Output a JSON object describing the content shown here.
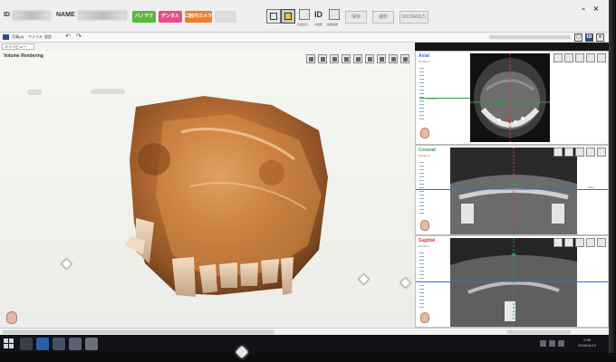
{
  "header": {
    "id_label": "ID",
    "name_label": "NAME",
    "modes": [
      {
        "label": "パノラマ",
        "color": "#5bb83f"
      },
      {
        "label": "デンタル",
        "color": "#e94b8a"
      },
      {
        "label": "口腔内カメラ",
        "color": "#f07b2c"
      }
    ],
    "id_icon": "ID",
    "captions": [
      "比較表示",
      "ID連携",
      "画像連携"
    ],
    "actions": {
      "save": "保存",
      "print": "撮影",
      "dicom": "DICOM出力"
    }
  },
  "menu": {
    "items": [
      "写真(A)",
      "ファイル",
      "設定"
    ],
    "submenu_label": "メインビュー"
  },
  "volume_panel": {
    "title": "Volume Rendering"
  },
  "mpr": {
    "axial": {
      "title": "Axial",
      "color": "#2a6fd6",
      "label_coronal": "Coronal"
    },
    "coronal": {
      "title": "Coronal",
      "color": "#2f9a4e",
      "label_axial": "Axial"
    },
    "sagittal": {
      "title": "Sagittal",
      "color": "#d43a3a"
    }
  },
  "taskbar": {
    "time": "9:56",
    "date": "2018/11/12"
  },
  "accent": {
    "blue": "#2a4e8a",
    "red": "#d43a3a",
    "green": "#2f9a4e"
  }
}
